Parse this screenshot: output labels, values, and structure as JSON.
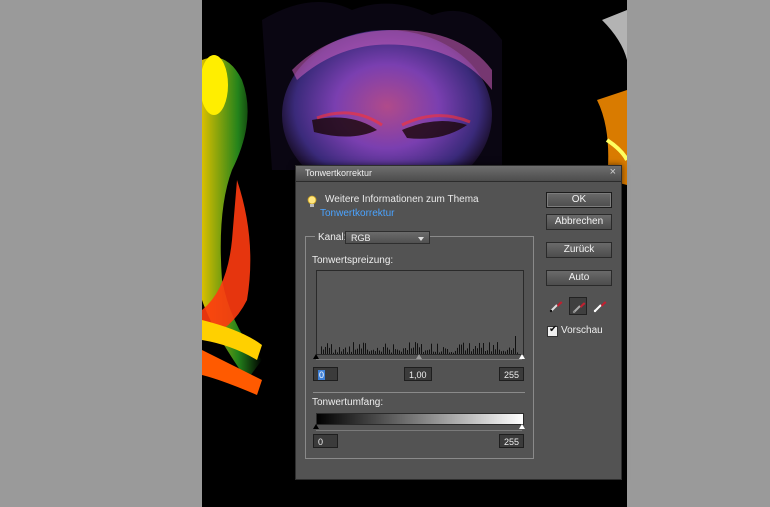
{
  "dialog": {
    "title": "Tonwertkorrektur",
    "close_glyph": "×",
    "info_text": "Weitere Informationen zum Thema",
    "info_link": "Tonwertkorrektur",
    "kanal_label": "Kanal:",
    "kanal_value": "RGB",
    "input_section_label": "Tonwertspreizung:",
    "input_black": "0",
    "input_gamma": "1,00",
    "input_white": "255",
    "output_section_label": "Tonwertumfang:",
    "output_black": "0",
    "output_white": "255"
  },
  "buttons": {
    "ok": "OK",
    "cancel": "Abbrechen",
    "reset": "Zurück",
    "auto": "Auto"
  },
  "preview": {
    "label": "Vorschau",
    "checked": true
  },
  "icons": {
    "droppers": [
      "black-eyedropper-icon",
      "gray-eyedropper-icon",
      "white-eyedropper-icon"
    ]
  },
  "colors": {
    "dialog_bg": "#535353",
    "link": "#4aa3ff"
  }
}
